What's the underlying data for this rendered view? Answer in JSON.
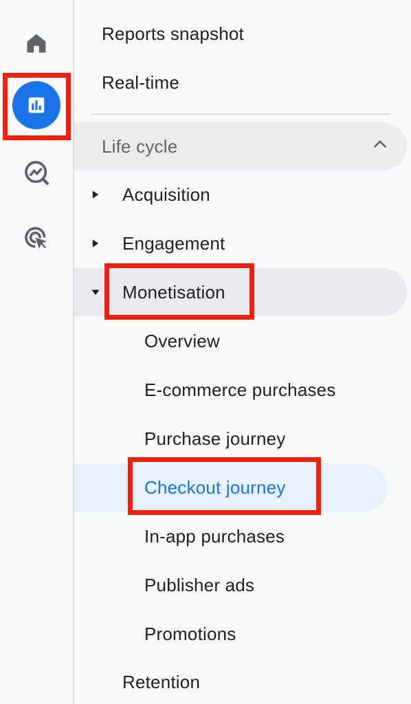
{
  "rail": {
    "icons": [
      "home-icon",
      "reports-icon",
      "explore-icon",
      "advertising-icon"
    ],
    "active_color": "#1a73e8"
  },
  "nav": {
    "reports_snapshot": "Reports snapshot",
    "real_time": "Real-time",
    "section": {
      "label": "Life cycle",
      "expanded": true
    },
    "groups": {
      "acquisition": "Acquisition",
      "engagement": "Engagement",
      "monetisation": "Monetisation",
      "retention": "Retention"
    },
    "monetisation_items": {
      "overview": "Overview",
      "ecommerce": "E-commerce purchases",
      "purchase_journey": "Purchase journey",
      "checkout_journey": "Checkout journey",
      "in_app": "In-app purchases",
      "publisher_ads": "Publisher ads",
      "promotions": "Promotions"
    },
    "selected": "Checkout journey"
  },
  "highlight_color": "#f01f0e"
}
